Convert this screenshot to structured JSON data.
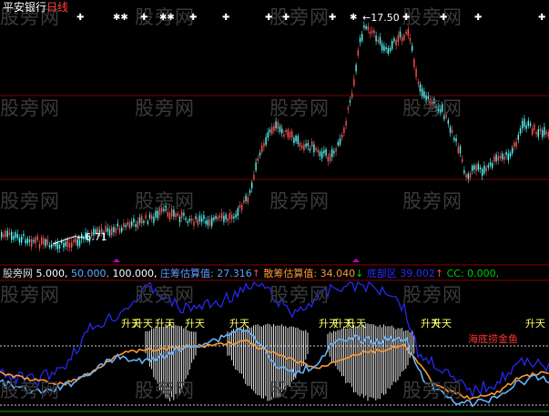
{
  "title": {
    "name": "平安银行",
    "period": "日线"
  },
  "price_panel": {
    "high_label": "←17.50",
    "low_label": "←6.71",
    "colors": {
      "up": "#ff5555",
      "down": "#54fcfc",
      "grid": "#8b0000"
    }
  },
  "indicator_bar": {
    "name": "股旁网",
    "p1": "5.000,",
    "p2": "50.000,",
    "p3": "100.000,",
    "zhuang_label": "庄筹估算值:",
    "zhuang_value": "27.316",
    "san_label": "散筹估算值:",
    "san_value": "34.040",
    "third_label": "底部区",
    "third_value": "39.002",
    "cc_label": "CC:",
    "cc_value": "0.000,"
  },
  "signals": {
    "rise": "升天",
    "sea": "海底捞金鱼"
  },
  "watermark": "股旁网",
  "chart_data": {
    "type": "candlestick",
    "panels": [
      "price",
      "indicator"
    ],
    "price_high": 17.5,
    "price_low": 6.71,
    "indicator_series": [
      {
        "name": "庄筹估算值",
        "last": 27.316,
        "color": "#2020ff"
      },
      {
        "name": "散筹估算值",
        "last": 34.04,
        "color": "#ff9933"
      },
      {
        "name": "CC",
        "last": 0.0,
        "color": "#55aaff"
      }
    ]
  }
}
